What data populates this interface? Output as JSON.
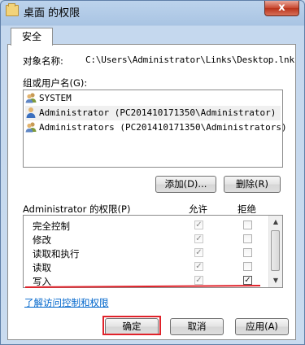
{
  "window": {
    "title": "桌面 的权限",
    "close_label": "x"
  },
  "tabs": [
    {
      "label": "安全"
    }
  ],
  "object": {
    "label": "对象名称:",
    "value": "C:\\Users\\Administrator\\Links\\Desktop.lnk"
  },
  "groups": {
    "label": "组或用户名(G):",
    "items": [
      {
        "name": "SYSTEM",
        "icon": "group-users-icon"
      },
      {
        "name": "Administrator (PC201410171350\\Administrator)",
        "icon": "user-icon",
        "selected": true
      },
      {
        "name": "Administrators (PC201410171350\\Administrators)",
        "icon": "group-users-icon"
      }
    ]
  },
  "buttons": {
    "add": "添加(D)...",
    "remove": "删除(R)",
    "ok": "确定",
    "cancel": "取消",
    "apply": "应用(A)"
  },
  "permissions": {
    "header": "Administrator 的权限(P)",
    "allow_col": "允许",
    "deny_col": "拒绝",
    "rows": [
      {
        "name": "完全控制",
        "allow": true,
        "deny": false
      },
      {
        "name": "修改",
        "allow": true,
        "deny": false
      },
      {
        "name": "读取和执行",
        "allow": true,
        "deny": false
      },
      {
        "name": "读取",
        "allow": true,
        "deny": false
      },
      {
        "name": "写入",
        "allow": true,
        "deny": true
      }
    ]
  },
  "link_text": "了解访问控制和权限",
  "colors": {
    "highlight": "#e0222a",
    "link": "#0066cc"
  }
}
